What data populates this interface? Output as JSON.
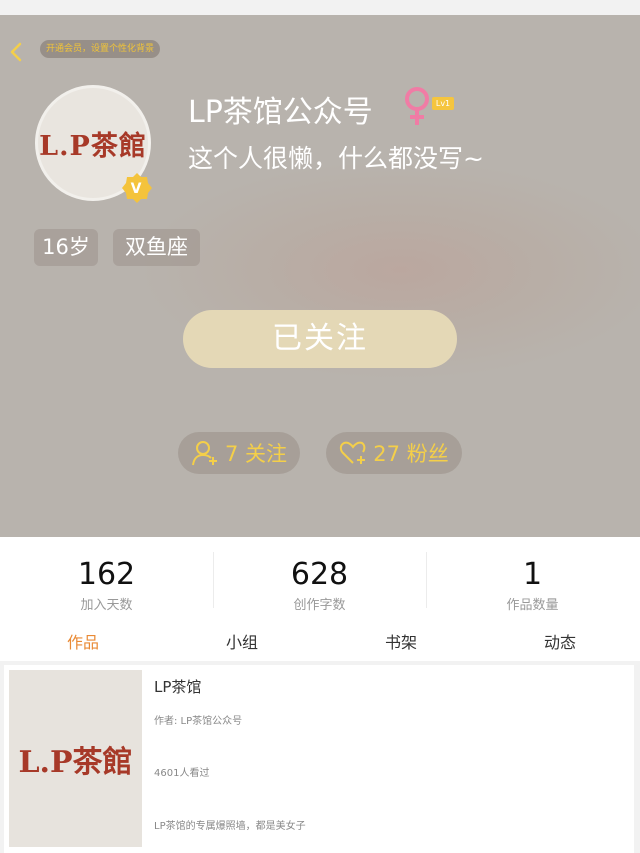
{
  "header": {
    "vip_banner": "开通会员，设置个性化背景",
    "avatar_text": "L.P茶館",
    "username": "LP茶馆公众号",
    "level": "Lv1",
    "bio": "这个人很懒，什么都没写~",
    "tags": [
      "16岁",
      "双鱼座"
    ],
    "follow_button": "已关注",
    "following": "7 关注",
    "fans": "27 粉丝"
  },
  "stats": [
    {
      "value": "162",
      "label": "加入天数"
    },
    {
      "value": "628",
      "label": "创作字数"
    },
    {
      "value": "1",
      "label": "作品数量"
    }
  ],
  "tabs": [
    {
      "label": "作品",
      "active": true
    },
    {
      "label": "小组",
      "active": false
    },
    {
      "label": "书架",
      "active": false
    },
    {
      "label": "动态",
      "active": false
    }
  ],
  "works": [
    {
      "cover_text": "L.P茶館",
      "title": "LP茶馆",
      "author": "作者: LP茶馆公众号",
      "views": "4601人看过",
      "description": "LP茶馆的专属爆照墙，都是美女子"
    }
  ],
  "icons": {
    "back": "back-chevron-icon",
    "verified": "verified-v-icon",
    "gender": "female-icon",
    "following": "add-user-icon",
    "fans": "heart-plus-icon"
  },
  "colors": {
    "accent_orange": "#e98a35",
    "gold": "#f4cf49",
    "gender_pink": "#f07ca5",
    "follow_button": "#e4d8b6"
  }
}
